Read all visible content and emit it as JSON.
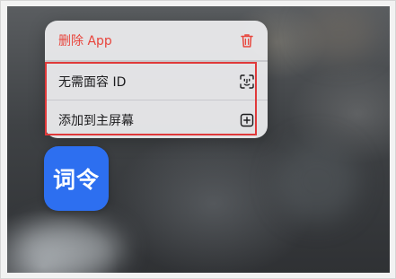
{
  "context_menu": {
    "items": [
      {
        "label": "删除 App",
        "icon": "trash-icon",
        "color": "#e8453c"
      },
      {
        "label": "无需面容 ID",
        "icon": "face-id-icon"
      },
      {
        "label": "添加到主屏幕",
        "icon": "plus-square-icon"
      }
    ]
  },
  "app": {
    "icon_text": "词令",
    "color": "#2d6ff0"
  },
  "annotation": {
    "highlight_color": "#e0393a"
  }
}
